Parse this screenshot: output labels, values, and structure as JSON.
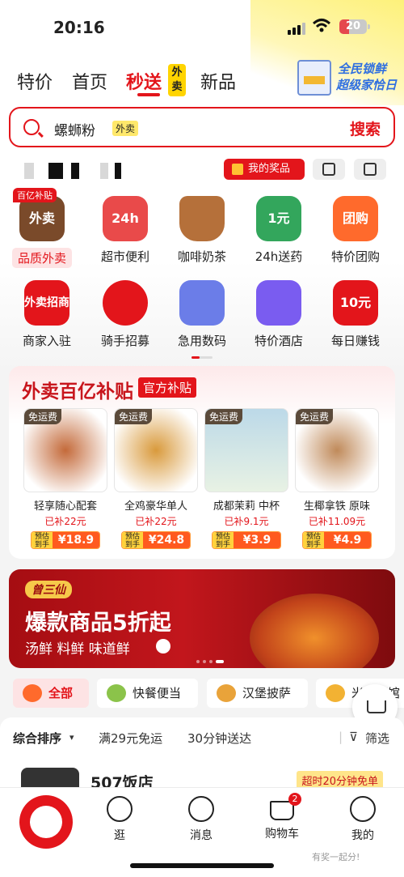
{
  "status": {
    "time": "20:16",
    "battery": "20"
  },
  "nav": {
    "tabs": [
      "特价",
      "首页",
      "秒送",
      "新品"
    ],
    "active": "秒送",
    "waimai_badge": "外卖",
    "promo_line1": "全民锁鲜",
    "promo_line2": "超级家恰日"
  },
  "search": {
    "query": "螺蛳粉",
    "tag": "外卖",
    "button": "搜索"
  },
  "toolbar": {
    "prize_button": "我的奖品"
  },
  "categories": [
    {
      "label": "品质外卖",
      "icon": "takeout-bag-icon",
      "badge": "百亿补贴",
      "text": "外卖",
      "color": "#7a4a2a"
    },
    {
      "label": "超市便利",
      "icon": "store-24h-icon",
      "text": "24h",
      "color": "#e94a4a"
    },
    {
      "label": "咖啡奶茶",
      "icon": "coffee-cup-icon",
      "text": "",
      "color": "#b5703a"
    },
    {
      "label": "24h送药",
      "icon": "medicine-box-icon",
      "text": "1元",
      "color": "#33a65c"
    },
    {
      "label": "特价团购",
      "icon": "group-buy-ticket-icon",
      "text": "团购",
      "color": "#ff6a2c"
    },
    {
      "label": "商家入驻",
      "icon": "merchant-join-icon",
      "text": "外卖招商",
      "color": "#e3151b"
    },
    {
      "label": "骑手招募",
      "icon": "rider-icon",
      "text": "",
      "color": "#e3151b"
    },
    {
      "label": "急用数码",
      "icon": "phone-digital-icon",
      "text": "",
      "color": "#6b7de8"
    },
    {
      "label": "特价酒店",
      "icon": "hotel-icon",
      "text": "",
      "color": "#7a5cf0"
    },
    {
      "label": "每日赚钱",
      "icon": "coupon-cards-icon",
      "text": "10元",
      "color": "#e3151b"
    }
  ],
  "subsidy": {
    "title": "外卖百亿补贴",
    "official": "官方补贴",
    "free_label": "免运费",
    "est_label": "预估到手",
    "products": [
      {
        "name": "轻享随心配套",
        "subsidy": "已补22元",
        "price": "¥18.9",
        "color": "#8a4b2a"
      },
      {
        "name": "全鸡豪华单人",
        "subsidy": "已补22元",
        "price": "¥24.8",
        "color": "#d99a3c"
      },
      {
        "name": "成都茉莉 中杯",
        "subsidy": "已补9.1元",
        "price": "¥3.9",
        "color": "#9cc4d8"
      },
      {
        "name": "生椰拿铁 原味",
        "subsidy": "已补11.09元",
        "price": "¥4.9",
        "color": "#c08a5a"
      }
    ]
  },
  "banner": {
    "brand": "曾三仙",
    "headline": "爆款商品5折起",
    "sub": "汤鲜 料鲜 味道鲜"
  },
  "chips": [
    "全部",
    "快餐便当",
    "汉堡披萨",
    "米粉面馆"
  ],
  "sort": {
    "main": "综合排序",
    "opt1": "满29元免运",
    "opt2": "30分钟送达",
    "filter": "筛选"
  },
  "store": {
    "name": "507饭店",
    "badge": "超时20分钟免单"
  },
  "tabbar": [
    {
      "label": "逛",
      "icon": "stroll-icon"
    },
    {
      "label": "消息",
      "icon": "message-icon"
    },
    {
      "label": "购物车",
      "icon": "cart-icon",
      "count": "2"
    },
    {
      "label": "我的",
      "icon": "profile-icon"
    }
  ],
  "watermark": "有奖一起分!"
}
